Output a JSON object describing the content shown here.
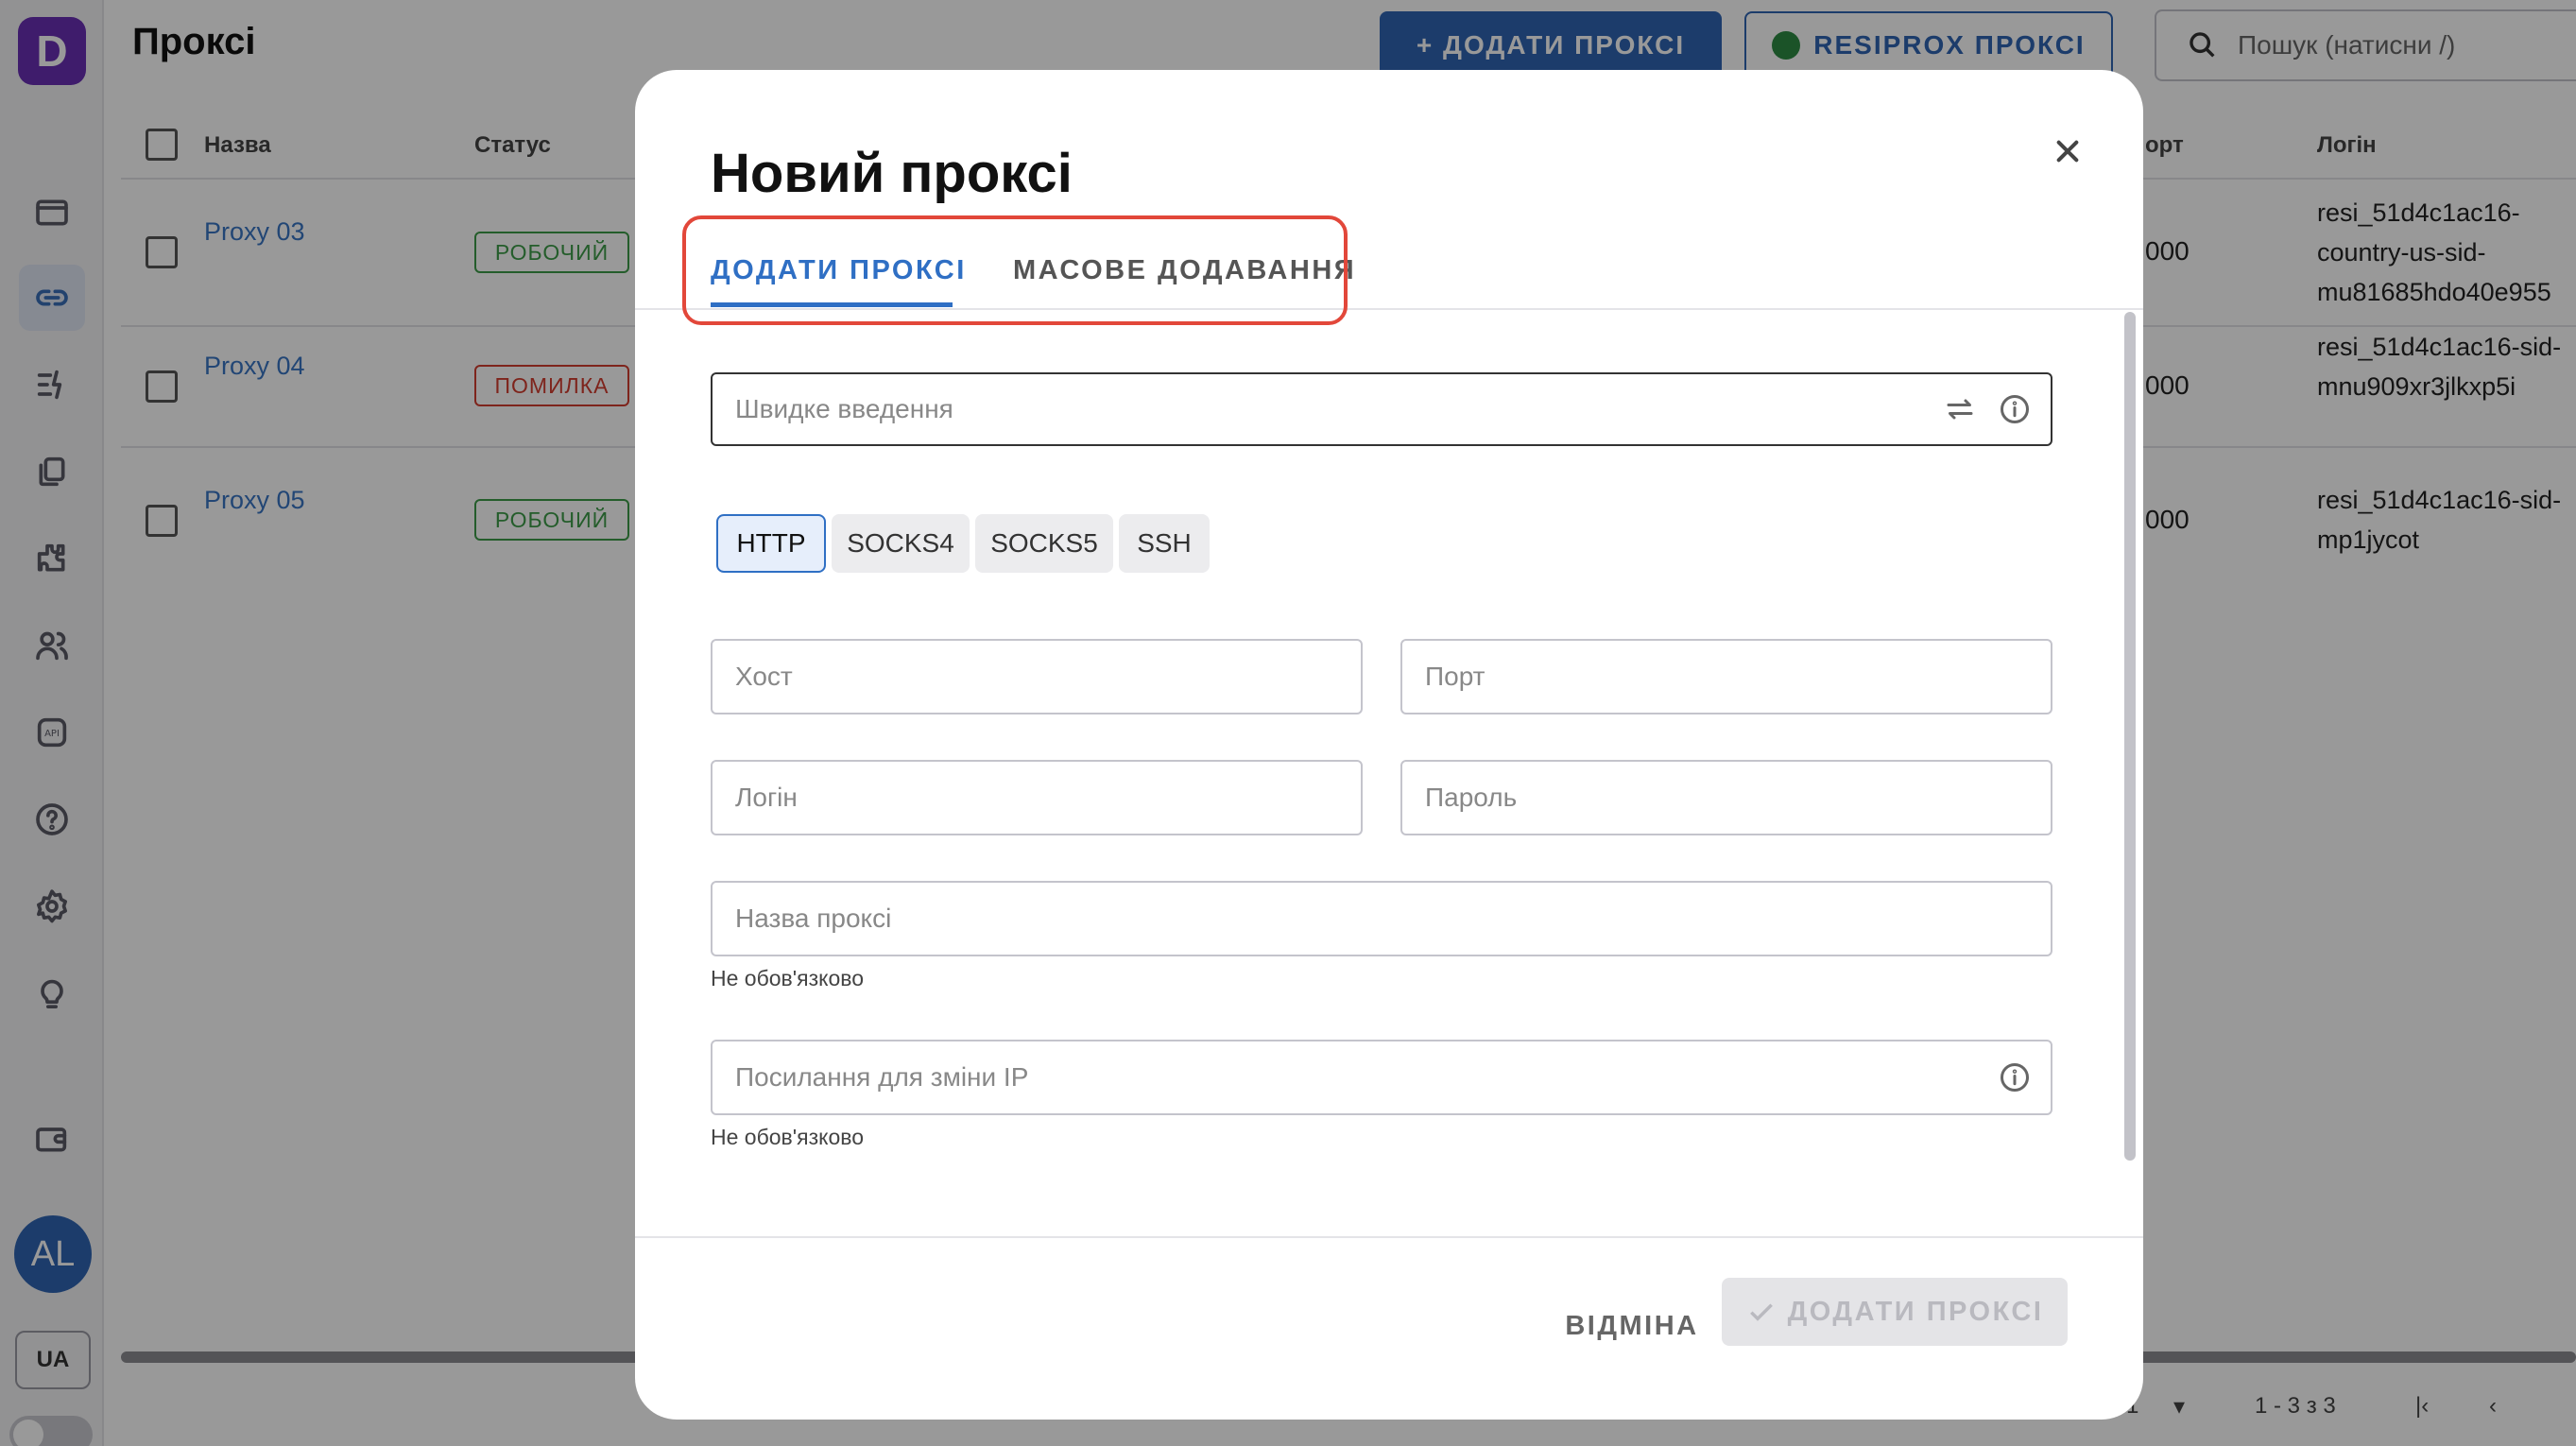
{
  "app": {
    "logo_letter": "D",
    "page_title": "Проксі",
    "add_proxy_button": "+ ДОДАТИ ПРОКСІ",
    "resiprox_button": "RESIPROX ПРОКСІ",
    "search_placeholder": "Пошук (натисни /)",
    "avatar_initials": "AL",
    "language": "UA"
  },
  "sidebar": {
    "icons": [
      "browser-icon",
      "link-icon",
      "automation-icon",
      "copy-icon",
      "extensions-icon",
      "users-icon",
      "api-icon",
      "help-icon",
      "settings-icon",
      "lightbulb-icon",
      "wallet-icon"
    ],
    "active": "link-icon"
  },
  "table": {
    "headers": {
      "name": "Назва",
      "status": "Статус",
      "port": "орт",
      "login": "Логін"
    },
    "rows": [
      {
        "name": "Proxy 03",
        "status": "РОБОЧИЙ",
        "status_kind": "ok",
        "port": "000",
        "login": "resi_51d4c1ac16-country-us-sid-mu81685hdo40e955"
      },
      {
        "name": "Proxy 04",
        "status": "ПОМИЛКА",
        "status_kind": "error",
        "port": "000",
        "login": "resi_51d4c1ac16-sid-mnu909xr3jlkxp5i"
      },
      {
        "name": "Proxy 05",
        "status": "РОБОЧИЙ",
        "status_kind": "ok",
        "port": "000",
        "login": "resi_51d4c1ac16-sid-mp1jycot"
      }
    ],
    "pagination": {
      "rows_per_page": "1",
      "range": "1 - 3 з 3"
    }
  },
  "dialog": {
    "title": "Новий проксі",
    "tabs": [
      {
        "label": "ДОДАТИ ПРОКСІ",
        "active": true
      },
      {
        "label": "МАСОВЕ ДОДАВАННЯ",
        "active": false
      }
    ],
    "quick_input_placeholder": "Швидке введення",
    "protocols": [
      "HTTP",
      "SOCKS4",
      "SOCKS5",
      "SSH"
    ],
    "selected_protocol": "HTTP",
    "fields": {
      "host": "Хост",
      "port": "Порт",
      "login": "Логін",
      "password": "Пароль",
      "proxy_name": "Назва проксі",
      "change_ip_link": "Посилання для зміни IP"
    },
    "optional_hint": "Не обов'язково",
    "cancel_button": "ВІДМІНА",
    "submit_button": "ДОДАТИ ПРОКСІ"
  },
  "colors": {
    "accent": "#2f6fc4",
    "brand": "#6a2fb4",
    "ok": "#3d9b48",
    "error": "#d33c2f",
    "highlight": "#e2473a"
  }
}
